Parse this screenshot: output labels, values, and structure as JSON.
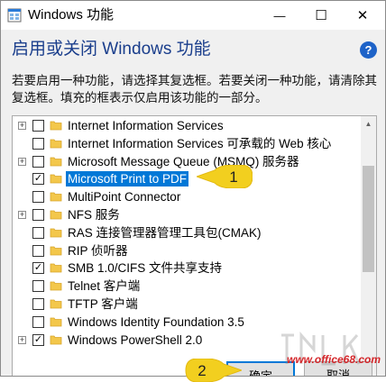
{
  "window": {
    "title": "Windows 功能",
    "controls": {
      "minimize": "—",
      "maximize": "☐",
      "close": "✕"
    }
  },
  "heading": "启用或关闭 Windows 功能",
  "help_label": "?",
  "description": "若要启用一种功能，请选择其复选框。若要关闭一种功能，请清除其复选框。填充的框表示仅启用该功能的一部分。",
  "features": [
    {
      "label": "Internet Information Services",
      "expander": "+",
      "state": "unchecked",
      "selected": false
    },
    {
      "label": "Internet Information Services 可承载的 Web 核心",
      "expander": "",
      "state": "unchecked",
      "selected": false
    },
    {
      "label": "Microsoft Message Queue (MSMQ) 服务器",
      "expander": "+",
      "state": "unchecked",
      "selected": false
    },
    {
      "label": "Microsoft Print to PDF",
      "expander": "",
      "state": "checked",
      "check_mark": "✓",
      "selected": true
    },
    {
      "label": "MultiPoint Connector",
      "expander": "",
      "state": "unchecked",
      "selected": false
    },
    {
      "label": "NFS 服务",
      "expander": "+",
      "state": "unchecked",
      "selected": false
    },
    {
      "label": "RAS 连接管理器管理工具包(CMAK)",
      "expander": "",
      "state": "unchecked",
      "selected": false
    },
    {
      "label": "RIP 侦听器",
      "expander": "",
      "state": "unchecked",
      "selected": false
    },
    {
      "label": "SMB 1.0/CIFS 文件共享支持",
      "expander": "",
      "state": "checked",
      "check_mark": "✓",
      "selected": false
    },
    {
      "label": "Telnet 客户端",
      "expander": "",
      "state": "unchecked",
      "selected": false
    },
    {
      "label": "TFTP 客户端",
      "expander": "",
      "state": "unchecked",
      "selected": false
    },
    {
      "label": "Windows Identity Foundation 3.5",
      "expander": "",
      "state": "unchecked",
      "selected": false
    },
    {
      "label": "Windows PowerShell 2.0",
      "expander": "+",
      "state": "checked",
      "check_mark": "✓",
      "selected": false
    }
  ],
  "callouts": [
    {
      "number": "1"
    },
    {
      "number": "2"
    }
  ],
  "buttons": {
    "ok": "确定",
    "cancel": "取消"
  },
  "watermark": {
    "url": "www.office68.com"
  },
  "colors": {
    "accent": "#0078d7",
    "heading": "#1a3e8c",
    "callout": "#f2cf1f",
    "help": "#1e63c8"
  }
}
